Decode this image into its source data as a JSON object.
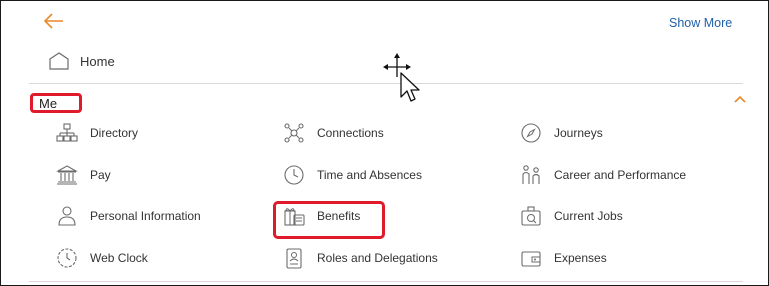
{
  "header": {
    "back_icon": "arrow-left-icon",
    "show_more_label": "Show More"
  },
  "home": {
    "icon": "home-icon",
    "label": "Home"
  },
  "section": {
    "title": "Me",
    "collapse_icon": "chevron-up-icon"
  },
  "items": [
    {
      "label": "Directory",
      "icon": "org-chart-icon"
    },
    {
      "label": "Connections",
      "icon": "network-icon"
    },
    {
      "label": "Journeys",
      "icon": "compass-icon"
    },
    {
      "label": "Pay",
      "icon": "bank-icon"
    },
    {
      "label": "Time and Absences",
      "icon": "clock-icon"
    },
    {
      "label": "Career and Performance",
      "icon": "career-icon"
    },
    {
      "label": "Personal Information",
      "icon": "person-icon"
    },
    {
      "label": "Benefits",
      "icon": "benefits-icon"
    },
    {
      "label": "Current Jobs",
      "icon": "current-jobs-icon"
    },
    {
      "label": "Web Clock",
      "icon": "web-clock-icon"
    },
    {
      "label": "Roles and Delegations",
      "icon": "id-badge-icon"
    },
    {
      "label": "Expenses",
      "icon": "wallet-icon"
    }
  ],
  "colors": {
    "accent_orange": "#e8892a",
    "link_blue": "#1f5fa8",
    "highlight_red": "#e0192b",
    "icon_gray": "#6b6b6b"
  }
}
